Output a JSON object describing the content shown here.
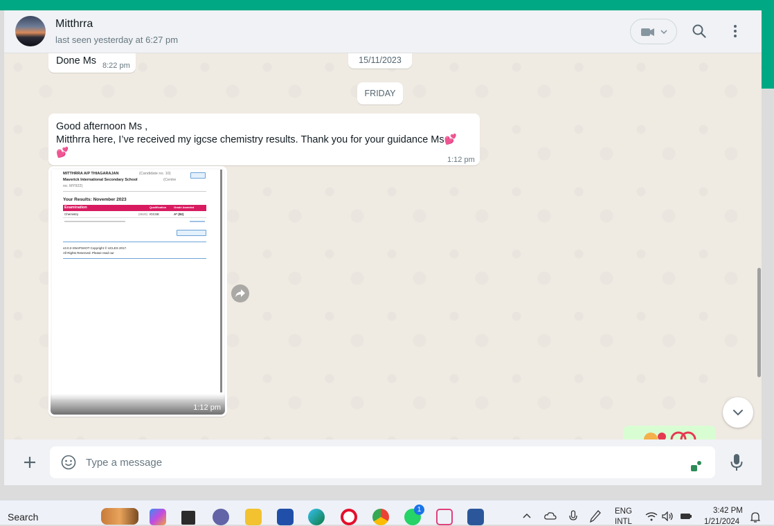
{
  "header": {
    "contact_name": "Mitthrra",
    "status": "last seen yesterday at 6:27 pm"
  },
  "messages": {
    "prev_text": "Done Ms",
    "prev_time": "8:22 pm",
    "date_pill_top": "15/11/2023",
    "date_pill_day": "FRIDAY",
    "greeting_line1": "Good afternoon Ms ,",
    "greeting_line2": "Mitthrra here, I’ve received my igcse chemistry results. Thank you for your guidance Ms💕",
    "greeting_line3": "💕",
    "greeting_time": "1:12 pm",
    "image_time": "1:12 pm"
  },
  "result_doc": {
    "candidate_name": "MITTHRRA A/P THIAGARAJAN",
    "candidate_no": "(Candidate no. 10)",
    "school": "Maverick International Secondary School",
    "centre": "(Centre",
    "centre_no": "no. MY922)",
    "heading": "Your Results: November 2023",
    "col_exam": "Examination",
    "col_qual": "Qualification",
    "col_grade": "Grade Awarded",
    "row_subject": "Chemistry",
    "row_code": "(0620)",
    "row_qual": "IGCSE",
    "row_grade": "A* (92)",
    "footer_version": "v3.0.2-SNAPSHOT Copyright © UCLES 2017.",
    "footer_rights": "All Rights Reserved. Please read our"
  },
  "composer": {
    "placeholder": "Type a message"
  },
  "taskbar": {
    "search_label": "Search",
    "lang_top": "ENG",
    "lang_bottom": "INTL",
    "clock_time": "3:42 PM",
    "clock_date": "1/21/2024",
    "whatsapp_badge": "1"
  }
}
